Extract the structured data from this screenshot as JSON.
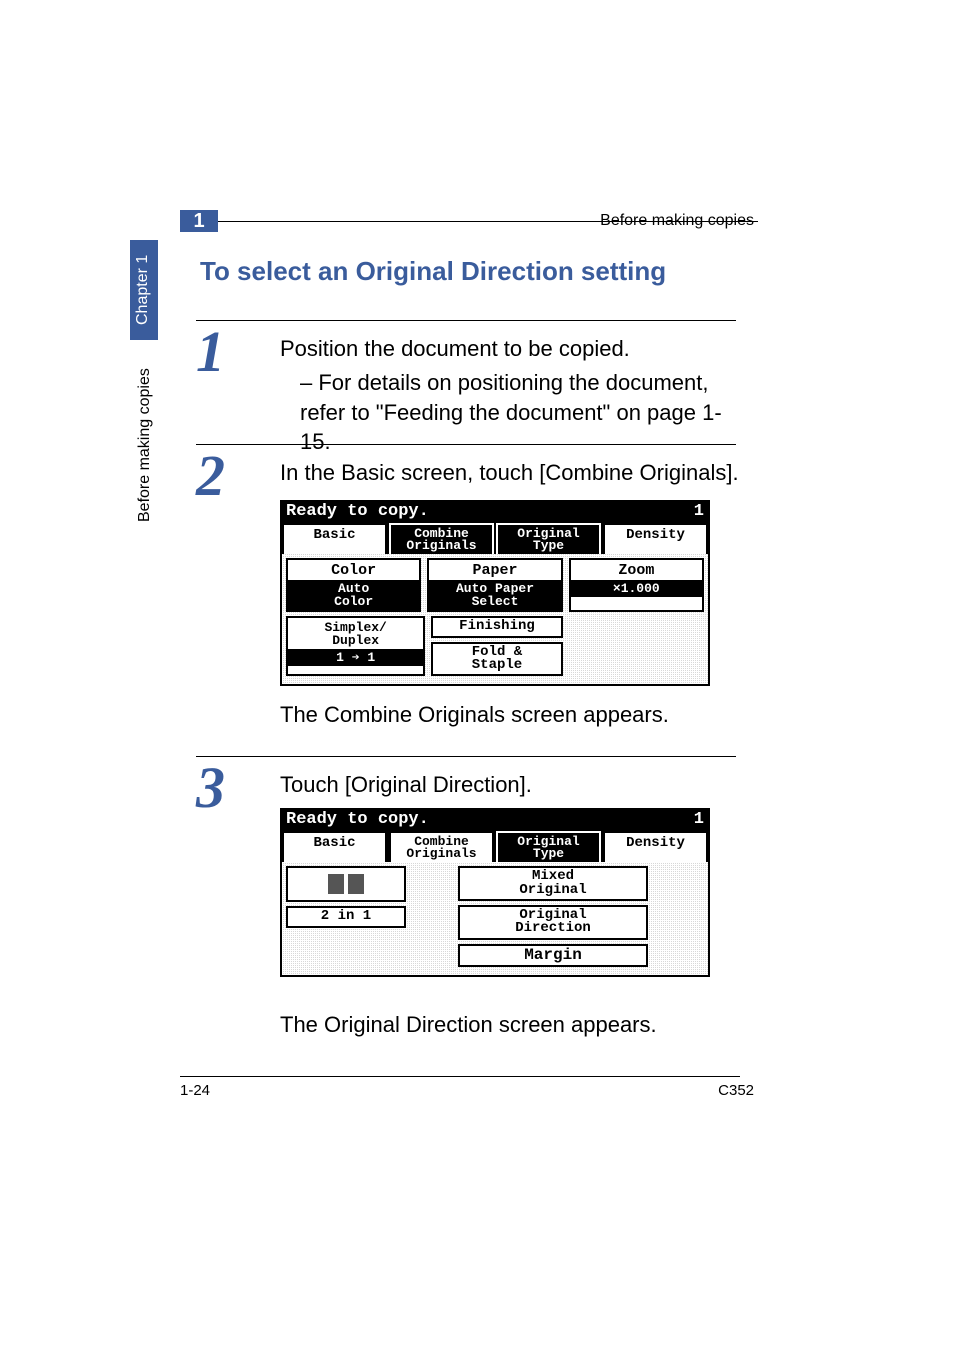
{
  "header": {
    "chapter_num": "1",
    "running_title": "Before making copies",
    "side_chapter": "Chapter 1",
    "side_section": "Before making copies"
  },
  "section_title": "To select an Original Direction setting",
  "steps": {
    "1": {
      "num": "1",
      "text": "Position the document to be copied.",
      "sub": "– For details on positioning the document, refer to \"Feeding the document\" on page 1-15."
    },
    "2": {
      "num": "2",
      "text": "In the Basic screen, touch [Combine Originals].",
      "after": "The Combine Originals screen appears."
    },
    "3": {
      "num": "3",
      "text": "Touch [Original Direction].",
      "after": "The Original Direction screen appears."
    }
  },
  "lcd1": {
    "status": "Ready to copy.",
    "page": "1",
    "tabs": {
      "basic": "Basic",
      "combine": "Combine\nOriginals",
      "original": "Original\nType",
      "density": "Density"
    },
    "cells": {
      "color_label": "Color",
      "color_val": "Auto\nColor",
      "paper_label": "Paper",
      "paper_val": "Auto Paper\nSelect",
      "zoom_label": "Zoom",
      "zoom_val": "×1.000",
      "simplex": "Simplex/\nDuplex",
      "simplex_val": "1 ➔ 1",
      "finishing": "Finishing",
      "fold": "Fold &\nStaple"
    }
  },
  "lcd2": {
    "status": "Ready to copy.",
    "page": "1",
    "tabs": {
      "basic": "Basic",
      "combine": "Combine\nOriginals",
      "original": "Original\nType",
      "density": "Density"
    },
    "btns": {
      "mixed": "Mixed\nOriginal",
      "direction": "Original\nDirection",
      "margin": "Margin",
      "twoinone": "2 in 1"
    }
  },
  "footer": {
    "left": "1-24",
    "right": "C352"
  }
}
